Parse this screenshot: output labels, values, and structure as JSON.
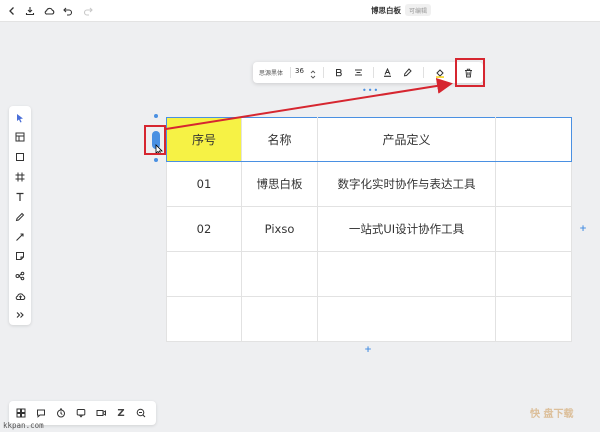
{
  "topbar": {
    "title": "博思白板",
    "badge": "可编辑"
  },
  "format_toolbar": {
    "font_name": "思源黑体",
    "font_size": "36"
  },
  "table": {
    "header": [
      "序号",
      "名称",
      "产品定义",
      ""
    ],
    "rows": [
      [
        "01",
        "博思白板",
        "数字化实时协作与表达工具",
        ""
      ],
      [
        "02",
        "Pixso",
        "一站式UI设计协作工具",
        ""
      ],
      [
        "",
        "",
        "",
        ""
      ],
      [
        "",
        "",
        "",
        ""
      ]
    ]
  },
  "bottom_toolbar": {
    "z_label": "Z"
  },
  "watermark": {
    "brand": "快 盘下载",
    "url": "kkpan.com"
  },
  "colors": {
    "accent": "#4a90e2",
    "highlight": "#d62630",
    "header_cell": "#f6f245"
  }
}
